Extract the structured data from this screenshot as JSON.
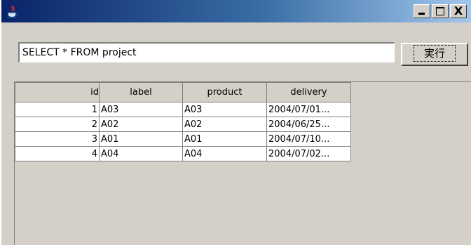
{
  "window": {
    "icon": "java-cup-icon",
    "controls": {
      "close": "X"
    }
  },
  "query": {
    "value": "SELECT * FROM project",
    "run_label": "実行"
  },
  "table": {
    "columns": [
      "id",
      "label",
      "product",
      "delivery"
    ],
    "rows": [
      [
        "1",
        "A03",
        "A03",
        "2004/07/01..."
      ],
      [
        "2",
        "A02",
        "A02",
        "2004/06/25..."
      ],
      [
        "3",
        "A01",
        "A01",
        "2004/07/10..."
      ],
      [
        "4",
        "A04",
        "A04",
        "2004/07/02..."
      ]
    ]
  }
}
